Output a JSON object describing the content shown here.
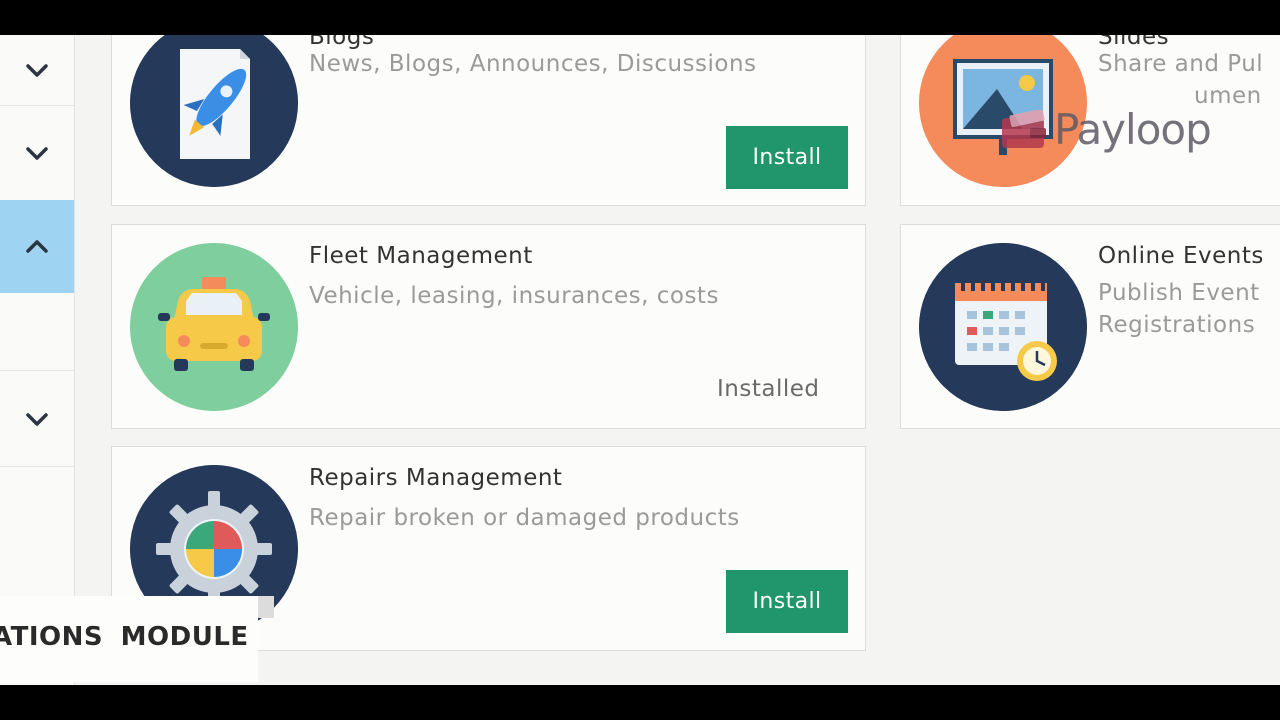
{
  "sidebar": {
    "rows": [
      {
        "icon": "chevron-down-icon",
        "active": false
      },
      {
        "icon": "chevron-down-icon",
        "active": false
      },
      {
        "icon": "chevron-up-icon",
        "active": true
      },
      {
        "icon": "",
        "active": false
      },
      {
        "icon": "chevron-down-icon",
        "active": false
      }
    ]
  },
  "cards": [
    {
      "title": "Blogs",
      "description": "News, Blogs, Announces, Discussions",
      "action": "Install",
      "icon": "rocket-document-icon"
    },
    {
      "title": "Slides",
      "description_line1": "Share and Pul",
      "description_line2": "umen",
      "icon": "slides-presentation-icon"
    },
    {
      "title": "Fleet Management",
      "description": "Vehicle, leasing, insurances, costs",
      "status": "Installed",
      "icon": "taxi-car-icon"
    },
    {
      "title": "Online Events",
      "description_line1": "Publish Event",
      "description_line2": "Registrations",
      "icon": "calendar-clock-icon"
    },
    {
      "title": "Repairs Management",
      "description": "Repair broken or damaged products",
      "action": "Install",
      "icon": "gear-icon"
    }
  ],
  "watermark": {
    "text": "Payloop"
  },
  "caption": {
    "text": "ATIONS MODULE"
  },
  "colors": {
    "install_green": "#21956b",
    "active_blue": "#9fd3f2",
    "navy": "#25395a",
    "orange": "#f58a5b",
    "mint": "#7fcf9e"
  }
}
